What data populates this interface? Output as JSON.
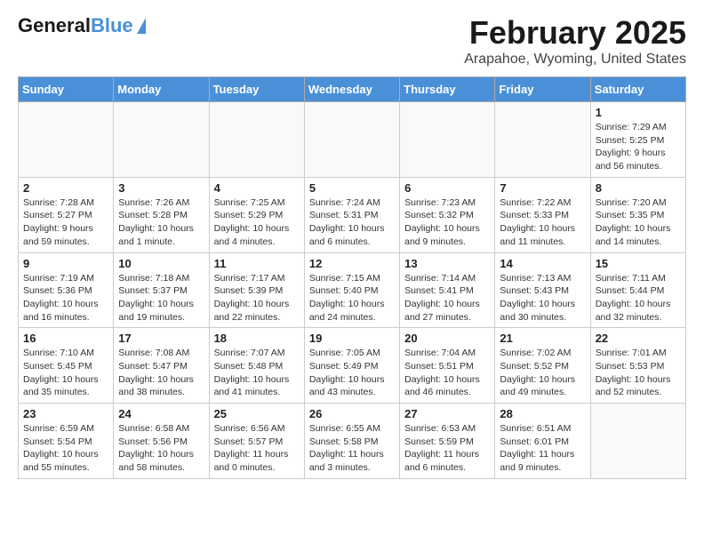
{
  "header": {
    "logo_general": "General",
    "logo_blue": "Blue",
    "title": "February 2025",
    "subtitle": "Arapahoe, Wyoming, United States"
  },
  "days_of_week": [
    "Sunday",
    "Monday",
    "Tuesday",
    "Wednesday",
    "Thursday",
    "Friday",
    "Saturday"
  ],
  "weeks": [
    [
      {
        "day": "",
        "info": ""
      },
      {
        "day": "",
        "info": ""
      },
      {
        "day": "",
        "info": ""
      },
      {
        "day": "",
        "info": ""
      },
      {
        "day": "",
        "info": ""
      },
      {
        "day": "",
        "info": ""
      },
      {
        "day": "1",
        "info": "Sunrise: 7:29 AM\nSunset: 5:25 PM\nDaylight: 9 hours\nand 56 minutes."
      }
    ],
    [
      {
        "day": "2",
        "info": "Sunrise: 7:28 AM\nSunset: 5:27 PM\nDaylight: 9 hours\nand 59 minutes."
      },
      {
        "day": "3",
        "info": "Sunrise: 7:26 AM\nSunset: 5:28 PM\nDaylight: 10 hours\nand 1 minute."
      },
      {
        "day": "4",
        "info": "Sunrise: 7:25 AM\nSunset: 5:29 PM\nDaylight: 10 hours\nand 4 minutes."
      },
      {
        "day": "5",
        "info": "Sunrise: 7:24 AM\nSunset: 5:31 PM\nDaylight: 10 hours\nand 6 minutes."
      },
      {
        "day": "6",
        "info": "Sunrise: 7:23 AM\nSunset: 5:32 PM\nDaylight: 10 hours\nand 9 minutes."
      },
      {
        "day": "7",
        "info": "Sunrise: 7:22 AM\nSunset: 5:33 PM\nDaylight: 10 hours\nand 11 minutes."
      },
      {
        "day": "8",
        "info": "Sunrise: 7:20 AM\nSunset: 5:35 PM\nDaylight: 10 hours\nand 14 minutes."
      }
    ],
    [
      {
        "day": "9",
        "info": "Sunrise: 7:19 AM\nSunset: 5:36 PM\nDaylight: 10 hours\nand 16 minutes."
      },
      {
        "day": "10",
        "info": "Sunrise: 7:18 AM\nSunset: 5:37 PM\nDaylight: 10 hours\nand 19 minutes."
      },
      {
        "day": "11",
        "info": "Sunrise: 7:17 AM\nSunset: 5:39 PM\nDaylight: 10 hours\nand 22 minutes."
      },
      {
        "day": "12",
        "info": "Sunrise: 7:15 AM\nSunset: 5:40 PM\nDaylight: 10 hours\nand 24 minutes."
      },
      {
        "day": "13",
        "info": "Sunrise: 7:14 AM\nSunset: 5:41 PM\nDaylight: 10 hours\nand 27 minutes."
      },
      {
        "day": "14",
        "info": "Sunrise: 7:13 AM\nSunset: 5:43 PM\nDaylight: 10 hours\nand 30 minutes."
      },
      {
        "day": "15",
        "info": "Sunrise: 7:11 AM\nSunset: 5:44 PM\nDaylight: 10 hours\nand 32 minutes."
      }
    ],
    [
      {
        "day": "16",
        "info": "Sunrise: 7:10 AM\nSunset: 5:45 PM\nDaylight: 10 hours\nand 35 minutes."
      },
      {
        "day": "17",
        "info": "Sunrise: 7:08 AM\nSunset: 5:47 PM\nDaylight: 10 hours\nand 38 minutes."
      },
      {
        "day": "18",
        "info": "Sunrise: 7:07 AM\nSunset: 5:48 PM\nDaylight: 10 hours\nand 41 minutes."
      },
      {
        "day": "19",
        "info": "Sunrise: 7:05 AM\nSunset: 5:49 PM\nDaylight: 10 hours\nand 43 minutes."
      },
      {
        "day": "20",
        "info": "Sunrise: 7:04 AM\nSunset: 5:51 PM\nDaylight: 10 hours\nand 46 minutes."
      },
      {
        "day": "21",
        "info": "Sunrise: 7:02 AM\nSunset: 5:52 PM\nDaylight: 10 hours\nand 49 minutes."
      },
      {
        "day": "22",
        "info": "Sunrise: 7:01 AM\nSunset: 5:53 PM\nDaylight: 10 hours\nand 52 minutes."
      }
    ],
    [
      {
        "day": "23",
        "info": "Sunrise: 6:59 AM\nSunset: 5:54 PM\nDaylight: 10 hours\nand 55 minutes."
      },
      {
        "day": "24",
        "info": "Sunrise: 6:58 AM\nSunset: 5:56 PM\nDaylight: 10 hours\nand 58 minutes."
      },
      {
        "day": "25",
        "info": "Sunrise: 6:56 AM\nSunset: 5:57 PM\nDaylight: 11 hours\nand 0 minutes."
      },
      {
        "day": "26",
        "info": "Sunrise: 6:55 AM\nSunset: 5:58 PM\nDaylight: 11 hours\nand 3 minutes."
      },
      {
        "day": "27",
        "info": "Sunrise: 6:53 AM\nSunset: 5:59 PM\nDaylight: 11 hours\nand 6 minutes."
      },
      {
        "day": "28",
        "info": "Sunrise: 6:51 AM\nSunset: 6:01 PM\nDaylight: 11 hours\nand 9 minutes."
      },
      {
        "day": "",
        "info": ""
      }
    ]
  ]
}
